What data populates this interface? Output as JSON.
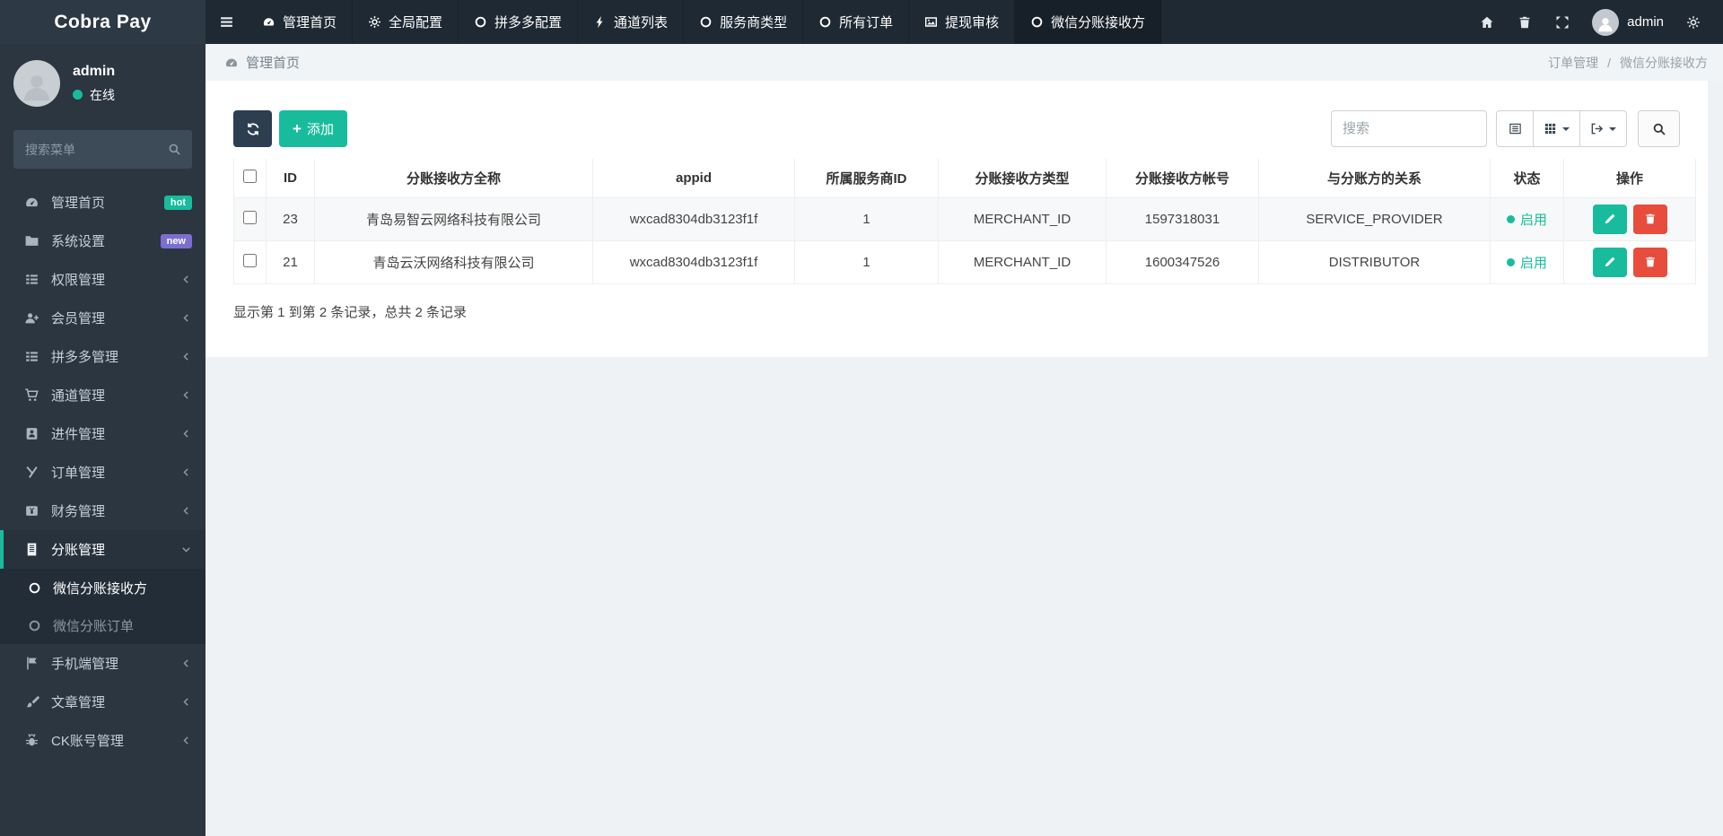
{
  "brand": {
    "title": "Cobra Pay"
  },
  "topbar": {
    "tabs": [
      {
        "label": "管理首页",
        "icon": "gauge-icon"
      },
      {
        "label": "全局配置",
        "icon": "gears-icon"
      },
      {
        "label": "拼多多配置",
        "icon": "circle-icon"
      },
      {
        "label": "通道列表",
        "icon": "bolt-icon"
      },
      {
        "label": "服务商类型",
        "icon": "circle-icon"
      },
      {
        "label": "所有订单",
        "icon": "circle-icon"
      },
      {
        "label": "提现审核",
        "icon": "image-icon"
      },
      {
        "label": "微信分账接收方",
        "icon": "circle-icon",
        "active": true
      }
    ],
    "username": "admin"
  },
  "sidebar": {
    "user": {
      "name": "admin",
      "status": "在线"
    },
    "search_placeholder": "搜索菜单",
    "items": [
      {
        "label": "管理首页",
        "badge": "hot",
        "icon": "gauge-icon"
      },
      {
        "label": "系统设置",
        "badge": "new",
        "icon": "folder-icon"
      },
      {
        "label": "权限管理",
        "icon": "list-icon"
      },
      {
        "label": "会员管理",
        "icon": "user-plus-icon"
      },
      {
        "label": "拼多多管理",
        "icon": "list-icon"
      },
      {
        "label": "通道管理",
        "icon": "cart-icon"
      },
      {
        "label": "进件管理",
        "icon": "id-card-icon"
      },
      {
        "label": "订单管理",
        "icon": "pointer-icon"
      },
      {
        "label": "财务管理",
        "icon": "money-icon"
      },
      {
        "label": "分账管理",
        "icon": "ledger-icon",
        "active": true,
        "expanded": true
      },
      {
        "label": "微信分账接收方",
        "icon": "circle-icon",
        "submenu": true,
        "active": true
      },
      {
        "label": "微信分账订单",
        "icon": "circle-icon",
        "submenu": true
      },
      {
        "label": "手机端管理",
        "icon": "flag-icon"
      },
      {
        "label": "文章管理",
        "icon": "brush-icon"
      },
      {
        "label": "CK账号管理",
        "icon": "bug-icon"
      }
    ]
  },
  "breadcrumb": {
    "home": "管理首页",
    "parent": "订单管理",
    "separator": "/",
    "current": "微信分账接收方"
  },
  "toolbar": {
    "add_label": "添加",
    "plus_glyph": "+",
    "search_placeholder": "搜索"
  },
  "table": {
    "headers": [
      "ID",
      "分账接收方全称",
      "appid",
      "所属服务商ID",
      "分账接收方类型",
      "分账接收方帐号",
      "与分账方的关系",
      "状态",
      "操作"
    ],
    "rows": [
      {
        "id": "23",
        "name": "青岛易智云网络科技有限公司",
        "appid": "wxcad8304db3123f1f",
        "provider_id": "1",
        "type": "MERCHANT_ID",
        "account": "1597318031",
        "relation": "SERVICE_PROVIDER",
        "status": "启用"
      },
      {
        "id": "21",
        "name": "青岛云沃网络科技有限公司",
        "appid": "wxcad8304db3123f1f",
        "provider_id": "1",
        "type": "MERCHANT_ID",
        "account": "1600347526",
        "relation": "DISTRIBUTOR",
        "status": "启用"
      }
    ],
    "footer": "显示第 1 到第 2 条记录，总共 2 条记录"
  },
  "colors": {
    "accent": "#18bc9c",
    "danger": "#e74c3c",
    "primary_dark": "#2c3e50",
    "badge_hot": "#18bc9c",
    "badge_new": "#7a6fd0",
    "topbar_bg": "#1f2933",
    "sidebar_bg": "#2b3641",
    "status_enabled": "#18bc9c"
  },
  "icons": {
    "hamburger": "☰",
    "circle": "○",
    "plus": "+",
    "separator": "/"
  }
}
